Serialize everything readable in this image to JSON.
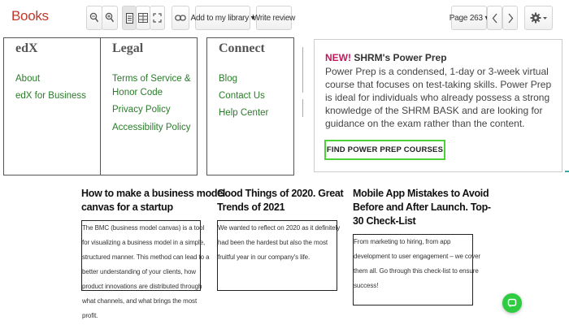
{
  "toolbar": {
    "logo": "Books",
    "add_library": "Add to my library ▾",
    "write_review": "Write review",
    "page": "Page 263 ▾",
    "icons": [
      "zoom-out-icon",
      "zoom-in-icon",
      "single-page-icon",
      "two-page-icon",
      "fullscreen-icon",
      "link-icon",
      "prev-page-icon",
      "next-page-icon",
      "settings-icon"
    ]
  },
  "footer": {
    "edx": {
      "title": "edX",
      "links": [
        "About",
        "edX for Business"
      ]
    },
    "legal": {
      "title": "Legal",
      "links": [
        "Terms of Service &",
        "Honor Code",
        "Privacy Policy",
        "Accessibility Policy"
      ]
    },
    "connect": {
      "title": "Connect",
      "links": [
        "Blog",
        "Contact Us",
        "Help Center"
      ]
    }
  },
  "promo": {
    "new": "NEW!",
    "title": "SHRM's Power Prep",
    "body": "Power Prep is a condensed, 1-day or 3-week virtual course that focuses on test-taking skills. Power Prep is ideal for individuals who already possess a strong knowledge of the SHRM BASK and are looking for guidance on the exam rather than the content.",
    "button": "FIND POWER PREP COURSES"
  },
  "articles": [
    {
      "title_lines": [
        "How to make a business model",
        "canvas for a startup"
      ],
      "text_lines": [
        "The BMC (business model canvas) is a tool",
        "for visualizing a business model in a simple,",
        "structured manner. This method can lead to a",
        "better understanding of your clients, how",
        "product innovations are distributed through",
        "what channels, and what brings the most",
        "profit."
      ]
    },
    {
      "title_lines": [
        "Good Things of 2020. Great",
        "Trends of 2021"
      ],
      "text_lines": [
        "We wanted to reflect on 2020 as it definitely",
        "had been the hardest but also the most",
        "fruitful year in our company's life."
      ]
    },
    {
      "title_lines": [
        "Mobile App Mistakes to Avoid",
        "Before and After Launch. Top-",
        "30 Check-List"
      ],
      "text_lines": [
        "From marketing to hiring, from app",
        "development to user engagement – we cover",
        "them all. Go through this check-list to ensure",
        "success!"
      ]
    }
  ],
  "colors": {
    "logo": "#c0392b",
    "link": "#2b7a2b",
    "new": "#c2185b",
    "button_border": "#4cd137",
    "chat": "#2ecc40"
  }
}
